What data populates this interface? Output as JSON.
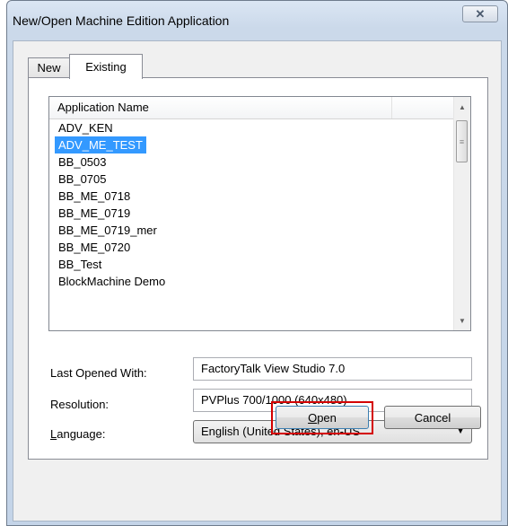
{
  "window": {
    "title": "New/Open Machine Edition Application",
    "close_glyph": "✕"
  },
  "tabs": [
    {
      "label": "New",
      "active": false
    },
    {
      "label": "Existing",
      "active": true
    }
  ],
  "list": {
    "column_header": "Application Name",
    "items": [
      "ADV_KEN",
      "ADV_ME_TEST",
      "BB_0503",
      "BB_0705",
      "BB_ME_0718",
      "BB_ME_0719",
      "BB_ME_0719_mer",
      "BB_ME_0720",
      "BB_Test",
      "BlockMachine Demo"
    ],
    "selected_index": 1
  },
  "fields": {
    "last_opened_label": "Last Opened With:",
    "last_opened_value": "FactoryTalk View Studio 7.0",
    "resolution_label": "Resolution:",
    "resolution_value": "PVPlus 700/1000 (640x480)",
    "language_label_first": "L",
    "language_label_rest": "anguage:",
    "language_value": "English (United States), en-US"
  },
  "buttons": {
    "open_first": "O",
    "open_rest": "pen",
    "cancel": "Cancel"
  },
  "colors": {
    "selection": "#3399ff",
    "highlight_box": "#d40000"
  }
}
